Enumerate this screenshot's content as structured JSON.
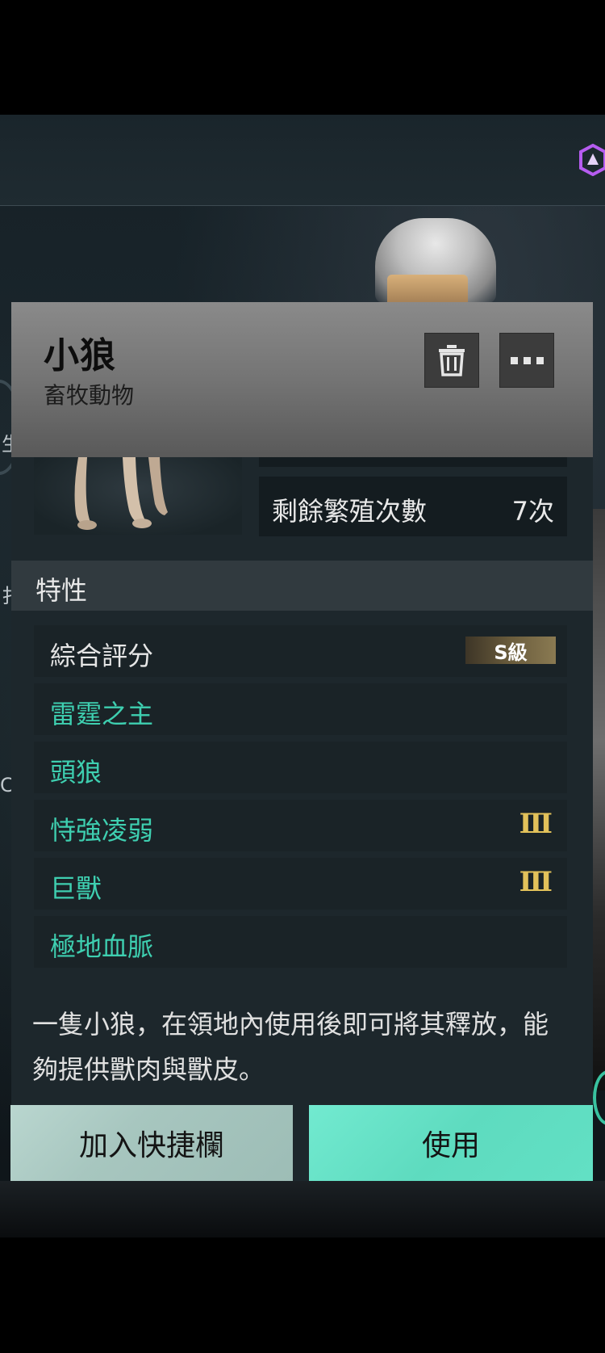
{
  "item": {
    "name": "小狼",
    "type": "畜牧動物"
  },
  "stats": {
    "breeding_label": "剩餘繁殖次數",
    "breeding_value": "7次"
  },
  "traits": {
    "section_title": "特性",
    "overall_label": "綜合評分",
    "overall_grade": "S級",
    "items": [
      {
        "label": "雷霆之主",
        "level": ""
      },
      {
        "label": "頭狼",
        "level": ""
      },
      {
        "label": "恃強凌弱",
        "level": "Ⅲ"
      },
      {
        "label": "巨獸",
        "level": "Ⅲ"
      },
      {
        "label": "極地血脈",
        "level": ""
      }
    ]
  },
  "description": "一隻小狼，在領地內使用後即可將其釋放，能夠提供獸肉與獸皮。",
  "actions": {
    "quick_label": "加入快捷欄",
    "use_label": "使用"
  },
  "background": {
    "left_chars": [
      "生",
      "扌",
      "C"
    ]
  },
  "icons": {
    "trash": "trash-icon",
    "more": "more-dots-icon",
    "top_right": "hexagon-icon"
  },
  "colors": {
    "accent_teal": "#3ecfb0",
    "button_use": "#5edbbf",
    "grade_gold": "#e2c15a"
  }
}
